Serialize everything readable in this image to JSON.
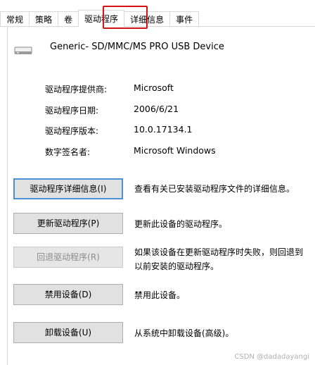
{
  "tabs": [
    {
      "label": "常规"
    },
    {
      "label": "策略"
    },
    {
      "label": "卷"
    },
    {
      "label": "驱动程序"
    },
    {
      "label": "详细信息"
    },
    {
      "label": "事件"
    }
  ],
  "device": {
    "icon": "usb-drive-icon",
    "name": "Generic- SD/MMC/MS PRO USB Device"
  },
  "properties": [
    {
      "label": "驱动程序提供商:",
      "value": "Microsoft"
    },
    {
      "label": "驱动程序日期:",
      "value": "2006/6/21"
    },
    {
      "label": "驱动程序版本:",
      "value": "10.0.17134.1"
    },
    {
      "label": "数字签名者:",
      "value": "Microsoft Windows"
    }
  ],
  "actions": [
    {
      "label": "驱动程序详细信息(I)",
      "desc": "查看有关已安装驱动程序文件的详细信息。"
    },
    {
      "label": "更新驱动程序(P)",
      "desc": "更新此设备的驱动程序。"
    },
    {
      "label": "回退驱动程序(R)",
      "desc": "如果该设备在更新驱动程序时失败，则回退到以前安装的驱动程序。"
    },
    {
      "label": "禁用设备(D)",
      "desc": "禁用此设备。"
    },
    {
      "label": "卸载设备(U)",
      "desc": "从系统中卸载设备(高级)。"
    }
  ],
  "watermark": "CSDN @dadadayangi",
  "colors": {
    "highlight": "#d21414",
    "focus": "#4a90d9"
  }
}
